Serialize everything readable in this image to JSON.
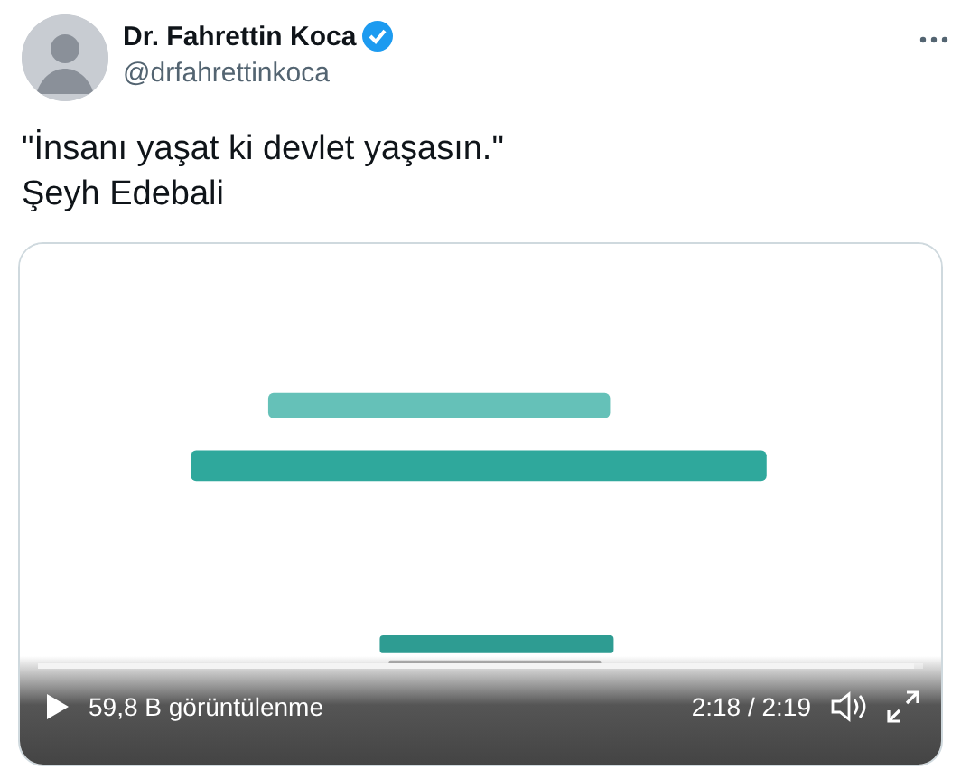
{
  "author": {
    "name": "Dr. Fahrettin Koca",
    "verified": true,
    "handle": "@drfahrettinkoca"
  },
  "tweet": {
    "lines": [
      "\"İnsanı yaşat ki devlet yaşasın.\"",
      "Şeyh Edebali"
    ]
  },
  "video": {
    "kind": "picture",
    "progress": {
      "level": 0.99
    },
    "views": "59,8 B görüntülenme",
    "time": "2:18 / 2:19"
  }
}
